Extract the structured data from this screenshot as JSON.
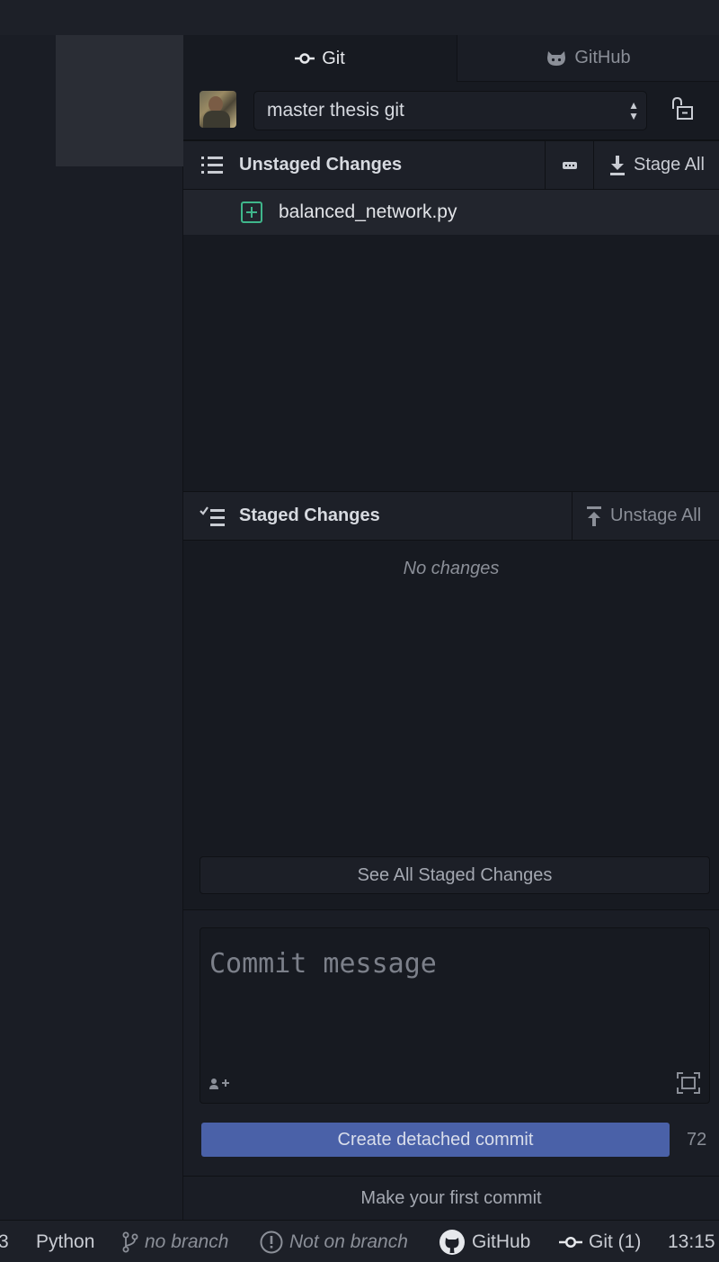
{
  "tabs": {
    "git_label": "Git",
    "github_label": "GitHub"
  },
  "repo": {
    "name": "master thesis git"
  },
  "unstaged": {
    "title": "Unstaged Changes",
    "stage_all_label": "Stage All",
    "files": [
      {
        "name": "balanced_network.py",
        "status": "added"
      }
    ]
  },
  "staged": {
    "title": "Staged Changes",
    "unstage_all_label": "Unstage All",
    "empty_text": "No changes",
    "see_all_label": "See All Staged Changes"
  },
  "commit": {
    "placeholder": "Commit message",
    "button_label": "Create detached commit",
    "remaining_chars": "72",
    "first_commit_label": "Make your first commit"
  },
  "status_bar": {
    "truncated_left": "3",
    "language": "Python",
    "branch": "no branch",
    "branch_status": "Not on branch",
    "github_label": "GitHub",
    "git_label": "Git (1)",
    "time": "13:15"
  },
  "colors": {
    "accent_button": "#4a61a8",
    "added_green": "#3fb68b",
    "background": "#171a21"
  }
}
